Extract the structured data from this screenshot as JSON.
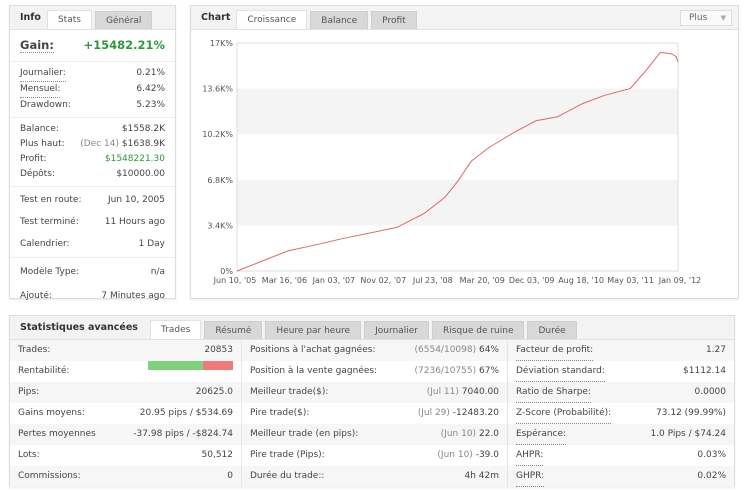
{
  "info": {
    "tabs": [
      "Info",
      "Stats",
      "Général"
    ],
    "active_tab": "Stats",
    "gain_label": "Gain:",
    "gain_value": "+15482.21%",
    "rates": [
      {
        "label": "Journalier:",
        "value": "0.21%"
      },
      {
        "label": "Mensuel:",
        "value": "6.42%"
      },
      {
        "label": "Drawdown:",
        "value": "5.23%"
      }
    ],
    "balance": {
      "label": "Balance:",
      "value": "$1558.2K"
    },
    "high": {
      "label": "Plus haut:",
      "date": "(Dec 14)",
      "value": "$1638.9K"
    },
    "profit": {
      "label": "Profit:",
      "value": "$1548221.30"
    },
    "deposits": {
      "label": "Dépôts:",
      "value": "$10000.00"
    },
    "dates": [
      {
        "label": "Test en route:",
        "value": "Jun 10, 2005"
      },
      {
        "label": "Test terminé:",
        "value": "11 Hours ago"
      },
      {
        "label": "Calendrier:",
        "value": "1 Day"
      }
    ],
    "model": {
      "label": "Modèle Type:",
      "value": "n/a"
    },
    "added": {
      "label": "Ajouté:",
      "value": "7 Minutes ago"
    }
  },
  "chart": {
    "title": "Chart",
    "tabs": [
      "Croissance",
      "Balance",
      "Profit"
    ],
    "active_tab": "Croissance",
    "more_label": "Plus",
    "line_color": "#e06666"
  },
  "chart_data": {
    "type": "line",
    "ylim": [
      0,
      17000
    ],
    "yticks": [
      "0%",
      "3.4K%",
      "6.8K%",
      "10.2K%",
      "13.6K%",
      "17K%"
    ],
    "xticks": [
      "Jun 10, '05",
      "Mar 16, '06",
      "Jan 03, '07",
      "Nov 02, '07",
      "Jul 23, '08",
      "Mar 20, '09",
      "Dec 03, '09",
      "Aug 18, '10",
      "May 03, '11",
      "Jan 09, '12"
    ],
    "ylabel_unit": "%",
    "series": [
      {
        "x": [
          "2005-06-10",
          "2006-03-16",
          "2006-09-01",
          "2007-01-03",
          "2007-11-02",
          "2008-04-01",
          "2008-07-23",
          "2008-10-01",
          "2008-12-15",
          "2009-03-20",
          "2009-08-01",
          "2009-12-03",
          "2010-04-01",
          "2010-08-18",
          "2010-12-15",
          "2011-05-03",
          "2011-08-01",
          "2011-10-15",
          "2011-12-14",
          "2012-01-09",
          "2012-01-20"
        ],
        "y": [
          0,
          1500,
          2000,
          2400,
          3250,
          4300,
          5500,
          6700,
          8200,
          9200,
          10300,
          11200,
          11500,
          12500,
          13100,
          13600,
          15000,
          16300,
          16200,
          16000,
          15600
        ]
      }
    ]
  },
  "advanced": {
    "title": "Statistiques avancées",
    "tabs": [
      "Trades",
      "Résumé",
      "Heure par heure",
      "Journalier",
      "Risque de ruine",
      "Durée"
    ],
    "active_tab": "Trades",
    "col1": [
      {
        "label": "Trades:",
        "value": "20853"
      },
      {
        "label": "Rentabilité:",
        "value": ""
      },
      {
        "label": "Pips:",
        "value": "20625.0"
      },
      {
        "label": "Gains moyens:",
        "value": "20.95 pips / $534.69"
      },
      {
        "label": "Pertes moyennes",
        "value": "-37.98 pips / -$824.74"
      },
      {
        "label": "Lots:",
        "value": "50,512"
      },
      {
        "label": "Commissions:",
        "value": "0"
      }
    ],
    "profitability_pct": 65,
    "col2": [
      {
        "label": "Positions à l'achat gagnées:",
        "muted": "(6554/10098)",
        "value": "64%"
      },
      {
        "label": "Position à la vente gagnées:",
        "muted": "(7236/10755)",
        "value": "67%"
      },
      {
        "label": "Meilleur trade($):",
        "muted": "(Jul 11)",
        "value": "7040.00"
      },
      {
        "label": "Pire trade($):",
        "muted": "(Jul 29)",
        "value": "-12483.20"
      },
      {
        "label": "Meilleur trade (en pips):",
        "muted": "(Jun 10)",
        "value": "22.0"
      },
      {
        "label": "Pire trade (Pips):",
        "muted": "(Jun 10)",
        "value": "-39.0"
      },
      {
        "label": "Durée du trade::",
        "muted": "",
        "value": "4h 42m"
      }
    ],
    "col3": [
      {
        "label": "Facteur de profit:",
        "value": "1.27"
      },
      {
        "label": "Déviation standard:",
        "value": "$1112.14"
      },
      {
        "label": "Ratio de Sharpe:",
        "value": "0.0000"
      },
      {
        "label": "Z-Score (Probabilité):",
        "value": "73.12 (99.99%)"
      },
      {
        "label": "Espérance:",
        "value": "1.0 Pips / $74.24"
      },
      {
        "label": "AHPR:",
        "value": "0.03%"
      },
      {
        "label": "GHPR:",
        "value": "0.02%"
      }
    ]
  }
}
